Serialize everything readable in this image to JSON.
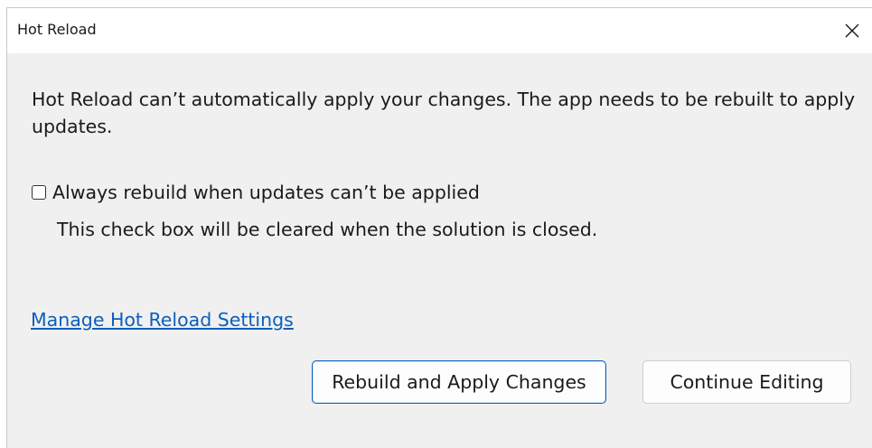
{
  "window": {
    "title": "Hot Reload",
    "close_icon": "close-icon"
  },
  "message": "Hot Reload can’t automatically apply your changes. The app needs to be rebuilt to apply updates.",
  "checkbox": {
    "label": "Always rebuild when updates can’t be applied",
    "checked": false
  },
  "note": "This check box will be cleared when the solution is closed.",
  "link": {
    "label": "Manage Hot Reload Settings"
  },
  "buttons": {
    "primary": "Rebuild and Apply Changes",
    "secondary": "Continue Editing"
  },
  "colors": {
    "dialog_background": "#f0f0f0",
    "titlebar_background": "#ffffff",
    "link": "#0b5fbd",
    "primary_border": "#0b5fbd"
  }
}
